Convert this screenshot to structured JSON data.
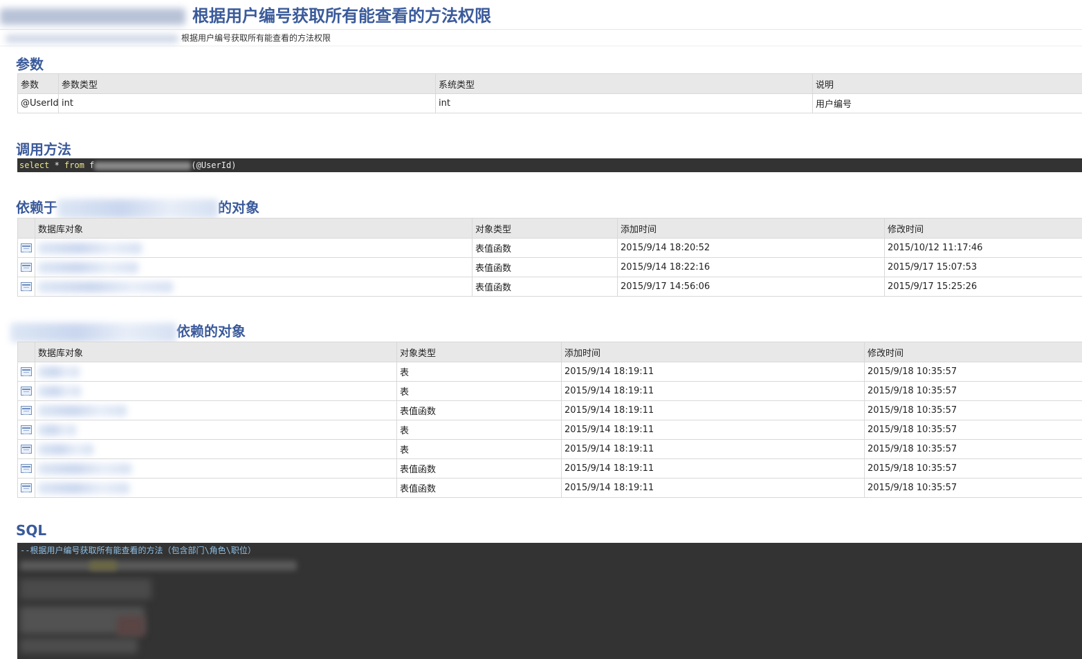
{
  "page_title": "根据用户编号获取所有能查看的方法权限",
  "breadcrumb_text": "根据用户编号获取所有能查看的方法权限",
  "sections": {
    "params": {
      "heading": "参数",
      "columns": [
        "参数",
        "参数类型",
        "系统类型",
        "说明"
      ],
      "rows": [
        {
          "name": "@UserId",
          "param_type": "int",
          "system_type": "int",
          "desc": "用户编号"
        }
      ]
    },
    "call": {
      "heading": "调用方法",
      "kw_select": "select",
      "star": " * ",
      "kw_from": "from",
      "prefix": " f",
      "suffix": "(@UserId)"
    },
    "depends_on": {
      "heading_prefix": "依赖于",
      "heading_suffix": "的对象",
      "columns": [
        "数据库对象",
        "对象类型",
        "添加时间",
        "修改时间"
      ],
      "rows": [
        {
          "type": "表值函数",
          "added": "2015/9/14 18:20:52",
          "modified": "2015/10/12 11:17:46"
        },
        {
          "type": "表值函数",
          "added": "2015/9/14 18:22:16",
          "modified": "2015/9/17 15:07:53"
        },
        {
          "type": "表值函数",
          "added": "2015/9/17 14:56:06",
          "modified": "2015/9/17 15:25:26"
        }
      ]
    },
    "depended_by": {
      "heading_suffix": "依赖的对象",
      "columns": [
        "数据库对象",
        "对象类型",
        "添加时间",
        "修改时间"
      ],
      "rows": [
        {
          "type": "表",
          "added": "2015/9/14 18:19:11",
          "modified": "2015/9/18 10:35:57"
        },
        {
          "type": "表",
          "added": "2015/9/14 18:19:11",
          "modified": "2015/9/18 10:35:57"
        },
        {
          "type": "表值函数",
          "added": "2015/9/14 18:19:11",
          "modified": "2015/9/18 10:35:57"
        },
        {
          "type": "表",
          "added": "2015/9/14 18:19:11",
          "modified": "2015/9/18 10:35:57"
        },
        {
          "type": "表",
          "added": "2015/9/14 18:19:11",
          "modified": "2015/9/18 10:35:57"
        },
        {
          "type": "表值函数",
          "added": "2015/9/14 18:19:11",
          "modified": "2015/9/18 10:35:57"
        },
        {
          "type": "表值函数",
          "added": "2015/9/14 18:19:11",
          "modified": "2015/9/18 10:35:57"
        }
      ]
    },
    "sql": {
      "heading": "SQL",
      "comment": "--根据用户编号获取所有能查看的方法（包含部门\\角色\\职位）"
    }
  },
  "colors": {
    "heading": "#3a5a9b",
    "code_bg": "#333333",
    "table_header_bg": "#e8e8e8"
  },
  "icons": {
    "db_object_row": "table-icon"
  }
}
